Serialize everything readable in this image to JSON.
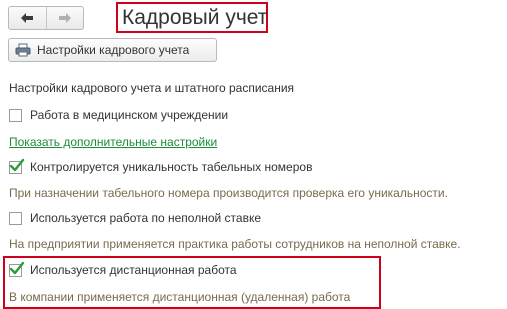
{
  "nav": {
    "back_icon": "arrow-left-icon",
    "forward_icon": "arrow-right-icon"
  },
  "header": {
    "title": "Кадровый учет"
  },
  "toolbar": {
    "settings_button_label": "Настройки кадрового учета",
    "settings_icon": "printer-settings-icon"
  },
  "section": {
    "title": "Настройки кадрового учета и штатного расписания"
  },
  "options": {
    "medical": {
      "label": "Работа в медицинском учреждении",
      "checked": false
    },
    "show_more_link": "Показать дополнительные настройки",
    "unique_numbers": {
      "label": "Контролируется уникальность табельных номеров",
      "checked": true,
      "hint": "При назначении табельного номера производится проверка его уникальности."
    },
    "part_time": {
      "label": "Используется работа по неполной ставке",
      "checked": false,
      "hint": "На предприятии применяется практика работы сотрудников на неполной ставке."
    },
    "remote": {
      "label": "Используется дистанционная работа",
      "checked": true,
      "hint": "В компании применяется дистанционная (удаленная) работа"
    }
  },
  "colors": {
    "highlight": "#d0021b",
    "link": "#1d8b3e",
    "checkmark": "#2a9d3a",
    "hint": "#7a6a4d"
  }
}
